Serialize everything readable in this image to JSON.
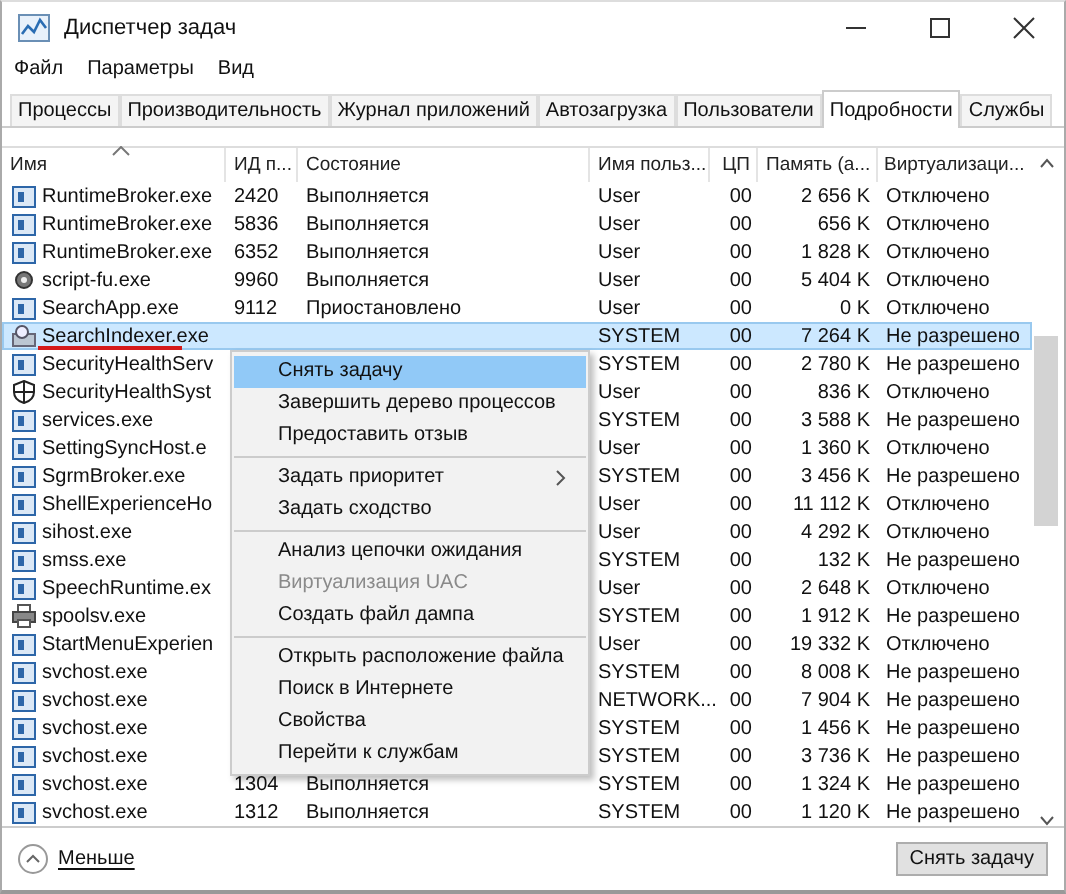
{
  "window": {
    "title": "Диспетчер задач"
  },
  "menu_bar": [
    "Файл",
    "Параметры",
    "Вид"
  ],
  "tabs": [
    {
      "label": "Процессы",
      "selected": false
    },
    {
      "label": "Производительность",
      "selected": false
    },
    {
      "label": "Журнал приложений",
      "selected": false
    },
    {
      "label": "Автозагрузка",
      "selected": false
    },
    {
      "label": "Пользователи",
      "selected": false
    },
    {
      "label": "Подробности",
      "selected": true
    },
    {
      "label": "Службы",
      "selected": false
    }
  ],
  "table": {
    "columns": [
      "Имя",
      "ИД п...",
      "Состояние",
      "Имя польз...",
      "ЦП",
      "Память (а...",
      "Виртуализаци..."
    ],
    "rows": [
      {
        "kind": "app",
        "name": "RuntimeBroker.exe",
        "pid": "2420",
        "status": "Выполняется",
        "user": "User",
        "cpu": "00",
        "memory": "2 656 K",
        "virtualization": "Отключено",
        "selected": false
      },
      {
        "kind": "app",
        "name": "RuntimeBroker.exe",
        "pid": "5836",
        "status": "Выполняется",
        "user": "User",
        "cpu": "00",
        "memory": "656 K",
        "virtualization": "Отключено",
        "selected": false
      },
      {
        "kind": "app",
        "name": "RuntimeBroker.exe",
        "pid": "6352",
        "status": "Выполняется",
        "user": "User",
        "cpu": "00",
        "memory": "1 828 K",
        "virtualization": "Отключено",
        "selected": false
      },
      {
        "kind": "tool",
        "name": "script-fu.exe",
        "pid": "9960",
        "status": "Выполняется",
        "user": "User",
        "cpu": "00",
        "memory": "5 404 K",
        "virtualization": "Отключено",
        "selected": false
      },
      {
        "kind": "app",
        "name": "SearchApp.exe",
        "pid": "9112",
        "status": "Приостановлено",
        "user": "User",
        "cpu": "00",
        "memory": "0 K",
        "virtualization": "Отключено",
        "selected": false
      },
      {
        "kind": "indexer",
        "name": "SearchIndexer.exe",
        "user": "SYSTEM",
        "cpu": "00",
        "memory": "7 264 K",
        "virtualization": "Не разрешено",
        "selected": true
      },
      {
        "kind": "app",
        "name": "SecurityHealthServ",
        "user": "SYSTEM",
        "cpu": "00",
        "memory": "2 780 K",
        "virtualization": "Не разрешено",
        "selected": false
      },
      {
        "kind": "shield",
        "name": "SecurityHealthSyst",
        "user": "User",
        "cpu": "00",
        "memory": "836 K",
        "virtualization": "Отключено",
        "selected": false
      },
      {
        "kind": "app",
        "name": "services.exe",
        "user": "SYSTEM",
        "cpu": "00",
        "memory": "3 588 K",
        "virtualization": "Не разрешено",
        "selected": false
      },
      {
        "kind": "app",
        "name": "SettingSyncHost.e",
        "user": "User",
        "cpu": "00",
        "memory": "1 360 K",
        "virtualization": "Отключено",
        "selected": false
      },
      {
        "kind": "app",
        "name": "SgrmBroker.exe",
        "user": "SYSTEM",
        "cpu": "00",
        "memory": "3 456 K",
        "virtualization": "Не разрешено",
        "selected": false
      },
      {
        "kind": "app",
        "name": "ShellExperienceHo",
        "user": "User",
        "cpu": "00",
        "memory": "11 112 K",
        "virtualization": "Отключено",
        "selected": false
      },
      {
        "kind": "app",
        "name": "sihost.exe",
        "user": "User",
        "cpu": "00",
        "memory": "4 292 K",
        "virtualization": "Отключено",
        "selected": false
      },
      {
        "kind": "app",
        "name": "smss.exe",
        "user": "SYSTEM",
        "cpu": "00",
        "memory": "132 K",
        "virtualization": "Не разрешено",
        "selected": false
      },
      {
        "kind": "app",
        "name": "SpeechRuntime.ex",
        "user": "User",
        "cpu": "00",
        "memory": "2 648 K",
        "virtualization": "Отключено",
        "selected": false
      },
      {
        "kind": "printer",
        "name": "spoolsv.exe",
        "user": "SYSTEM",
        "cpu": "00",
        "memory": "1 912 K",
        "virtualization": "Не разрешено",
        "selected": false
      },
      {
        "kind": "app",
        "name": "StartMenuExperien",
        "user": "User",
        "cpu": "00",
        "memory": "19 332 K",
        "virtualization": "Отключено",
        "selected": false
      },
      {
        "kind": "app",
        "name": "svchost.exe",
        "user": "SYSTEM",
        "cpu": "00",
        "memory": "8 008 K",
        "virtualization": "Не разрешено",
        "selected": false
      },
      {
        "kind": "app",
        "name": "svchost.exe",
        "user": "NETWORK...",
        "cpu": "00",
        "memory": "7 904 K",
        "virtualization": "Не разрешено",
        "selected": false
      },
      {
        "kind": "app",
        "name": "svchost.exe",
        "user": "SYSTEM",
        "cpu": "00",
        "memory": "1 456 K",
        "virtualization": "Не разрешено",
        "selected": false
      },
      {
        "kind": "app",
        "name": "svchost.exe",
        "user": "SYSTEM",
        "cpu": "00",
        "memory": "3 736 K",
        "virtualization": "Не разрешено",
        "selected": false
      },
      {
        "kind": "app",
        "name": "svchost.exe",
        "pid": "1304",
        "status": "Выполняется",
        "user": "SYSTEM",
        "cpu": "00",
        "memory": "1 324 K",
        "virtualization": "Не разрешено",
        "selected": false
      },
      {
        "kind": "app",
        "name": "svchost.exe",
        "pid": "1312",
        "status": "Выполняется",
        "user": "SYSTEM",
        "cpu": "00",
        "memory": "1 120 K",
        "virtualization": "Не разрешено",
        "selected": false
      }
    ]
  },
  "context_menu": [
    {
      "kind": "item",
      "label": "Снять задачу",
      "selected": true,
      "disabled": false,
      "submenu": false
    },
    {
      "kind": "item",
      "label": "Завершить дерево процессов",
      "selected": false,
      "disabled": false,
      "submenu": false
    },
    {
      "kind": "item",
      "label": "Предоставить отзыв",
      "selected": false,
      "disabled": false,
      "submenu": false
    },
    {
      "kind": "separator"
    },
    {
      "kind": "item",
      "label": "Задать приоритет",
      "selected": false,
      "disabled": false,
      "submenu": true
    },
    {
      "kind": "item",
      "label": "Задать сходство",
      "selected": false,
      "disabled": false,
      "submenu": false
    },
    {
      "kind": "separator"
    },
    {
      "kind": "item",
      "label": "Анализ цепочки ожидания",
      "selected": false,
      "disabled": false,
      "submenu": false
    },
    {
      "kind": "item",
      "label": "Виртуализация UAC",
      "selected": false,
      "disabled": true,
      "submenu": false
    },
    {
      "kind": "item",
      "label": "Создать файл дампа",
      "selected": false,
      "disabled": false,
      "submenu": false
    },
    {
      "kind": "separator"
    },
    {
      "kind": "item",
      "label": "Открыть расположение файла",
      "selected": false,
      "disabled": false,
      "submenu": false
    },
    {
      "kind": "item",
      "label": "Поиск в Интернете",
      "selected": false,
      "disabled": false,
      "submenu": false
    },
    {
      "kind": "item",
      "label": "Свойства",
      "selected": false,
      "disabled": false,
      "submenu": false
    },
    {
      "kind": "item",
      "label": "Перейти к службам",
      "selected": false,
      "disabled": false,
      "submenu": false
    }
  ],
  "footer": {
    "toggle": "Меньше",
    "button": "Снять задачу"
  }
}
